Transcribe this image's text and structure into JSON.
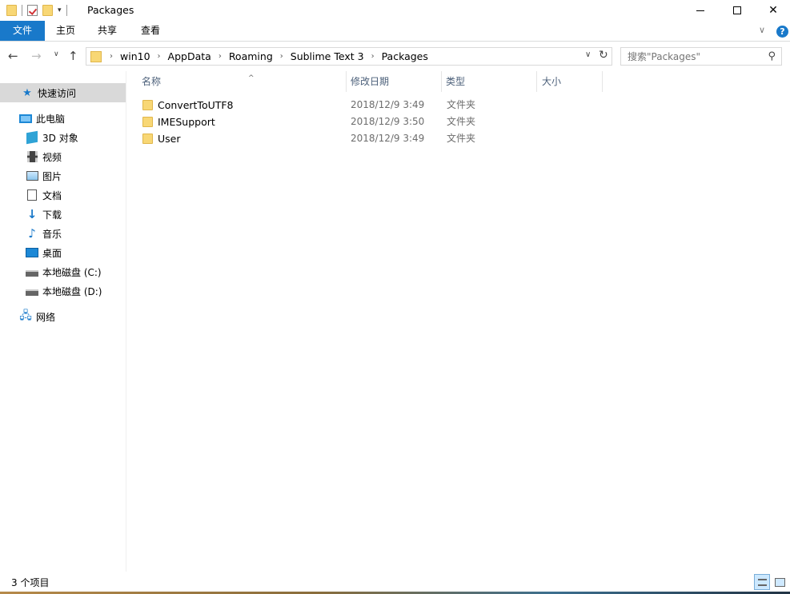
{
  "window": {
    "title": "Packages"
  },
  "ribbon": {
    "tabs": [
      "文件",
      "主页",
      "共享",
      "查看"
    ],
    "help": "?"
  },
  "navigation": {
    "breadcrumbs": [
      "win10",
      "AppData",
      "Roaming",
      "Sublime Text 3",
      "Packages"
    ],
    "search_placeholder": "搜索\"Packages\""
  },
  "sidebar": {
    "items": [
      {
        "label": "快速访问",
        "icon": "star-icon"
      },
      {
        "label": "此电脑",
        "icon": "computer-icon"
      },
      {
        "label": "3D 对象",
        "icon": "3d-objects-icon"
      },
      {
        "label": "视频",
        "icon": "video-icon"
      },
      {
        "label": "图片",
        "icon": "pictures-icon"
      },
      {
        "label": "文档",
        "icon": "documents-icon"
      },
      {
        "label": "下载",
        "icon": "download-icon"
      },
      {
        "label": "音乐",
        "icon": "music-icon"
      },
      {
        "label": "桌面",
        "icon": "desktop-icon"
      },
      {
        "label": "本地磁盘 (C:)",
        "icon": "drive-c-icon"
      },
      {
        "label": "本地磁盘 (D:)",
        "icon": "drive-d-icon"
      },
      {
        "label": "网络",
        "icon": "network-icon"
      }
    ]
  },
  "file_list": {
    "columns": [
      "名称",
      "修改日期",
      "类型",
      "大小"
    ],
    "rows": [
      {
        "name": "ConvertToUTF8",
        "date": "2018/12/9 3:49",
        "type": "文件夹",
        "size": ""
      },
      {
        "name": "IMESupport",
        "date": "2018/12/9 3:50",
        "type": "文件夹",
        "size": ""
      },
      {
        "name": "User",
        "date": "2018/12/9 3:49",
        "type": "文件夹",
        "size": ""
      }
    ]
  },
  "status": {
    "item_count": "3 个项目"
  },
  "colors": {
    "accent": "#1979ca",
    "selected_sidebar": "#d9d9d9",
    "folder": "#f8d775"
  }
}
